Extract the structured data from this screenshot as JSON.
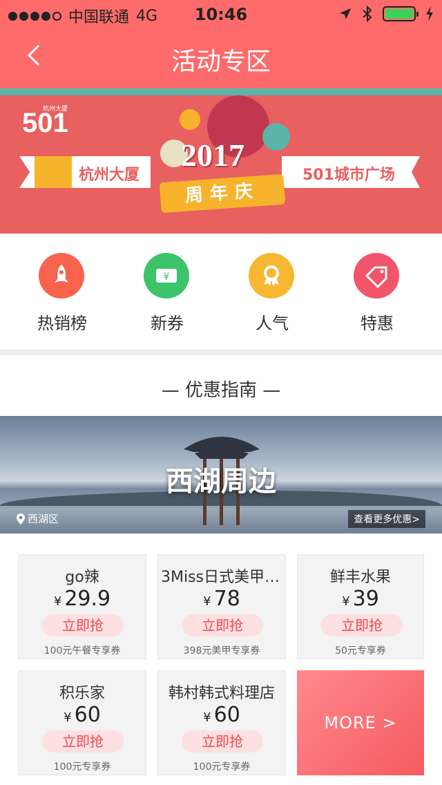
{
  "status_bar": {
    "carrier": "中国联通",
    "network": "4G",
    "time": "10:46"
  },
  "nav": {
    "title": "活动专区",
    "back_icon": "chevron-left-icon"
  },
  "banner": {
    "logo": "501",
    "logo_small": "杭州大厦",
    "left_ribbon": "杭州大厦",
    "right_ribbon": "501城市广场",
    "year": "2017",
    "subtitle": "周年庆"
  },
  "categories": [
    {
      "label": "热销榜",
      "icon": "rocket-icon",
      "color": "#f8634e"
    },
    {
      "label": "新券",
      "icon": "ticket-icon",
      "color": "#3bc46a"
    },
    {
      "label": "人气",
      "icon": "medal-icon",
      "color": "#f7b731"
    },
    {
      "label": "特惠",
      "icon": "tag-icon",
      "color": "#f2556a"
    }
  ],
  "section": {
    "title": "— 优惠指南 —",
    "feature_title": "西湖周边",
    "area": "西湖区",
    "more_link": "查看更多优惠>"
  },
  "deals": [
    {
      "name": "go辣",
      "currency": "¥",
      "price": "29.9",
      "button": "立即抢",
      "note": "100元午餐专享券"
    },
    {
      "name": "3Miss日式美甲美..",
      "currency": "¥",
      "price": "78",
      "button": "立即抢",
      "note": "398元美甲专享券"
    },
    {
      "name": "鲜丰水果",
      "currency": "¥",
      "price": "39",
      "button": "立即抢",
      "note": "50元专享券"
    },
    {
      "name": "积乐家",
      "currency": "¥",
      "price": "60",
      "button": "立即抢",
      "note": "100元专享券"
    },
    {
      "name": "韩村韩式料理店",
      "currency": "¥",
      "price": "60",
      "button": "立即抢",
      "note": "100元专享券"
    }
  ],
  "more_card": "MORE >",
  "colors": {
    "primary": "#ff6b6b",
    "accent_strip": "#5bb3a9",
    "button_text": "#f0494f",
    "button_bg": "#fde0e2"
  }
}
